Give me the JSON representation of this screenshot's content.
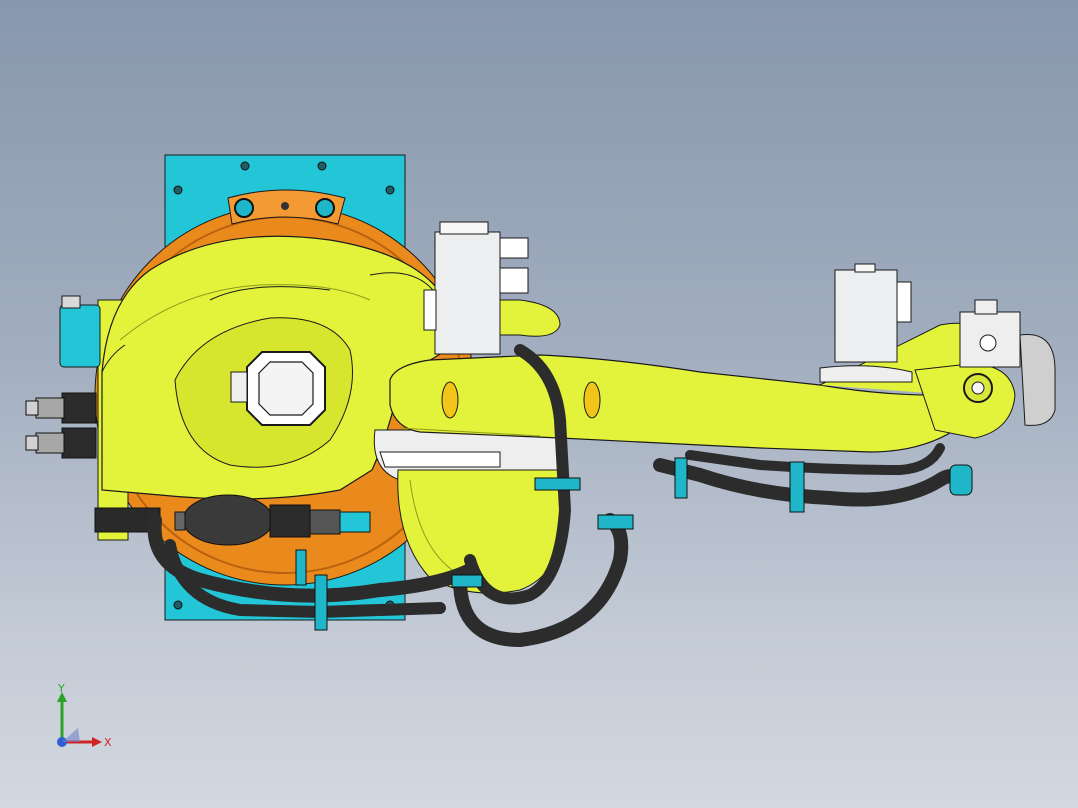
{
  "viewport": {
    "view_name": "",
    "background_top": "#8797ad",
    "background_bottom": "#d3d8e0"
  },
  "colors": {
    "housing_yellow": "#e3f23a",
    "housing_shadow": "#b9c82a",
    "flange_orange": "#ea8a1c",
    "base_plate_cyan": "#22c6d6",
    "clamp_cyan": "#1eb6c8",
    "motor_white": "#eceeef",
    "cable_black": "#2c2c2c",
    "edge_line": "#1a1a1a"
  },
  "triad": {
    "x_label": "X",
    "y_label": "Y",
    "x_icon": "x-axis-arrow-icon",
    "y_icon": "y-axis-arrow-icon",
    "z_icon": "z-axis-dot-icon"
  }
}
